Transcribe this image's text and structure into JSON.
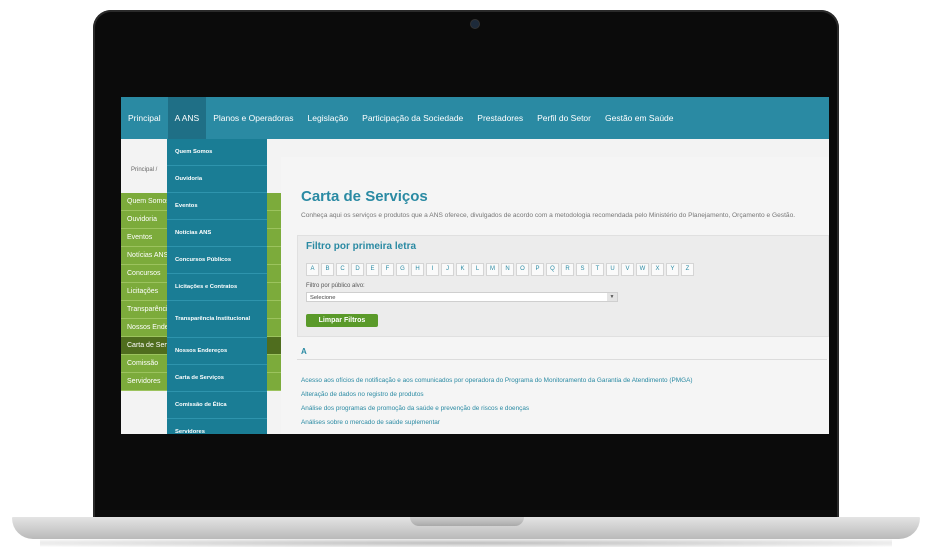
{
  "nav": {
    "items": [
      "Principal",
      "A ANS",
      "Planos e Operadoras",
      "Legislação",
      "Participação da Sociedade",
      "Prestadores",
      "Perfil do Setor",
      "Gestão em Saúde"
    ],
    "active_index": 1
  },
  "breadcrumb": "Principal /",
  "sidebar": {
    "items": [
      "Quem Somos",
      "Ouvidoria",
      "Eventos",
      "Notícias ANS",
      "Concursos",
      "Licitações",
      "Transparência",
      "Nossos Endereços",
      "Carta de Serviços",
      "Comissão",
      "Servidores"
    ]
  },
  "dropdown": {
    "items": [
      "Quem Somos",
      "Ouvidoria",
      "Eventos",
      "Notícias ANS",
      "Concursos Públicos",
      "Licitações e Contratos",
      "Transparência Institucional",
      "Nossos Endereços",
      "Carta de Serviços",
      "Comissão de Ética",
      "Servidores"
    ]
  },
  "content": {
    "title": "Carta de Serviços",
    "intro": "Conheça aqui os serviços e produtos que a ANS oferece, divulgados de acordo com a metodologia recomendada pelo Ministério do Planejamento, Orçamento e Gestão.",
    "filter": {
      "title": "Filtro por primeira letra",
      "letters": [
        "A",
        "B",
        "C",
        "D",
        "E",
        "F",
        "G",
        "H",
        "I",
        "J",
        "K",
        "L",
        "M",
        "N",
        "O",
        "P",
        "Q",
        "R",
        "S",
        "T",
        "U",
        "V",
        "W",
        "X",
        "Y",
        "Z"
      ],
      "audience_label": "Filtro por público alvo:",
      "select_value": "Selecione",
      "clear_button": "Limpar Filtros"
    },
    "section_letter": "A",
    "services": [
      "Acesso aos ofícios de notificação e aos comunicados por operadora do Programa do Monitoramento da Garantia de Atendimento (PMGA)",
      "Alteração de dados no registro de produtos",
      "Análise dos programas de promoção da saúde e prevenção de riscos e doenças",
      "Análises sobre o mercado de saúde suplementar"
    ]
  },
  "colors": {
    "nav": "#2a8aa3",
    "dropdown": "#1a7d95",
    "sidebar": "#7cab3b",
    "button": "#5a9a2a"
  }
}
